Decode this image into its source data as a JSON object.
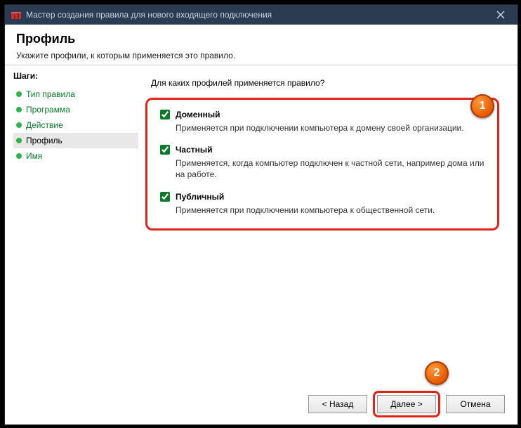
{
  "title": "Мастер создания правила для нового входящего подключения",
  "header": {
    "heading": "Профиль",
    "sub": "Укажите профили, к которым применяется это правило."
  },
  "steps": {
    "title": "Шаги:",
    "items": [
      {
        "label": "Тип правила",
        "state": "completed"
      },
      {
        "label": "Программа",
        "state": "completed"
      },
      {
        "label": "Действие",
        "state": "completed"
      },
      {
        "label": "Профиль",
        "state": "current"
      },
      {
        "label": "Имя",
        "state": "pending"
      }
    ]
  },
  "main": {
    "prompt": "Для каких профилей применяется правило?",
    "options": [
      {
        "name": "Доменный",
        "checked": true,
        "desc": "Применяется при подключении компьютера к домену своей организации."
      },
      {
        "name": "Частный",
        "checked": true,
        "desc": "Применяется, когда компьютер подключен к частной сети, например дома или на работе."
      },
      {
        "name": "Публичный",
        "checked": true,
        "desc": "Применяется при подключении компьютера к общественной сети."
      }
    ]
  },
  "buttons": {
    "back": "< Назад",
    "next": "Далее >",
    "cancel": "Отмена"
  },
  "badges": {
    "one": "1",
    "two": "2"
  }
}
